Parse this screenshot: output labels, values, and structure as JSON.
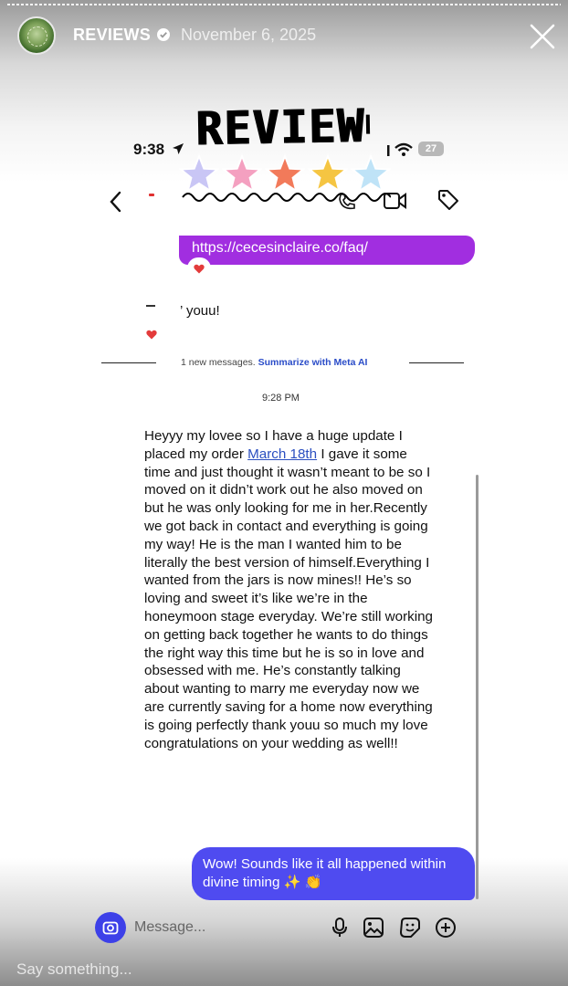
{
  "story": {
    "account_name": "REVIEWS",
    "date": "November 6, 2025",
    "reply_placeholder": "Say something..."
  },
  "sticker": {
    "word": "REVIEW",
    "star_colors": [
      "#c9c6f5",
      "#f4a0c0",
      "#f27a5a",
      "#f5c542",
      "#bfe3f7"
    ]
  },
  "phone": {
    "time": "9:38",
    "battery": "27"
  },
  "chat": {
    "link_message": "https://cecesinclaire.co/faq/",
    "received_snippet": "’ youu!",
    "new_messages": "1 new messages.",
    "summarize_label": "Summarize with Meta AI",
    "timestamp": "9:28 PM",
    "message_before_link": "Heyyy my lovee so I have a huge update I placed my order ",
    "message_link": "March 18th",
    "message_after_link": " I gave it some time and just thought it wasn’t meant to be so I moved on it didn’t work out he also moved on but he was only looking for me in her.Recently we got back in contact and everything is going my way! He is the man I wanted him to be literally the best version of himself.Everything I wanted from the jars is now mines!! He’s so loving and sweet it’s like we’re in the honeymoon stage everyday. We’re still working on getting back together he wants to do things the right way this time but he is so in love and obsessed with me. He’s constantly talking about wanting to marry me everyday now we are currently saving for a home now everything is going perfectly thank youu so much my love congratulations on your wedding as well!!",
    "sent_reply": "Wow! Sounds like it all happened within divine timing ✨ 👏",
    "composer_placeholder": "Message..."
  },
  "colors": {
    "link_bubble": "#a12ee0",
    "sent_bubble": "#4f4bf0",
    "camera_button": "#3d40e8",
    "link_text": "#2b4fc0"
  },
  "icons": [
    "verified-icon",
    "close-icon",
    "location-arrow-icon",
    "signal-icon",
    "wifi-icon",
    "back-chevron-icon",
    "phone-icon",
    "video-icon",
    "tag-icon",
    "heart-icon",
    "camera-icon",
    "microphone-icon",
    "gallery-icon",
    "sticker-icon",
    "plus-circle-icon"
  ]
}
